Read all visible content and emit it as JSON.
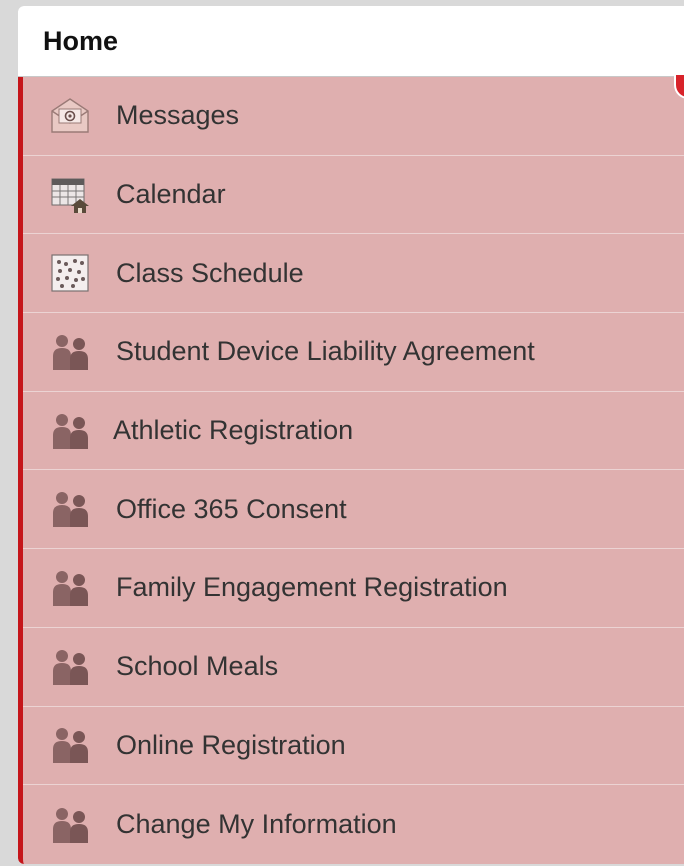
{
  "header": {
    "title": "Home"
  },
  "menu": {
    "items": [
      {
        "label": "Messages",
        "icon": "envelope-icon"
      },
      {
        "label": "Calendar",
        "icon": "calendar-icon"
      },
      {
        "label": "Class Schedule",
        "icon": "schedule-grid-icon"
      },
      {
        "label": "Student Device Liability Agreement",
        "icon": "people-icon"
      },
      {
        "label": "Athletic Registration",
        "icon": "people-icon"
      },
      {
        "label": "Office 365 Consent",
        "icon": "people-icon"
      },
      {
        "label": "Family Engagement Registration",
        "icon": "people-icon"
      },
      {
        "label": "School Meals",
        "icon": "people-icon"
      },
      {
        "label": "Online Registration",
        "icon": "people-icon"
      },
      {
        "label": "Change My Information",
        "icon": "people-icon"
      }
    ]
  },
  "colors": {
    "menu_bg": "#dfafaf",
    "accent": "#c5151a",
    "header_bg": "#ffffff"
  }
}
